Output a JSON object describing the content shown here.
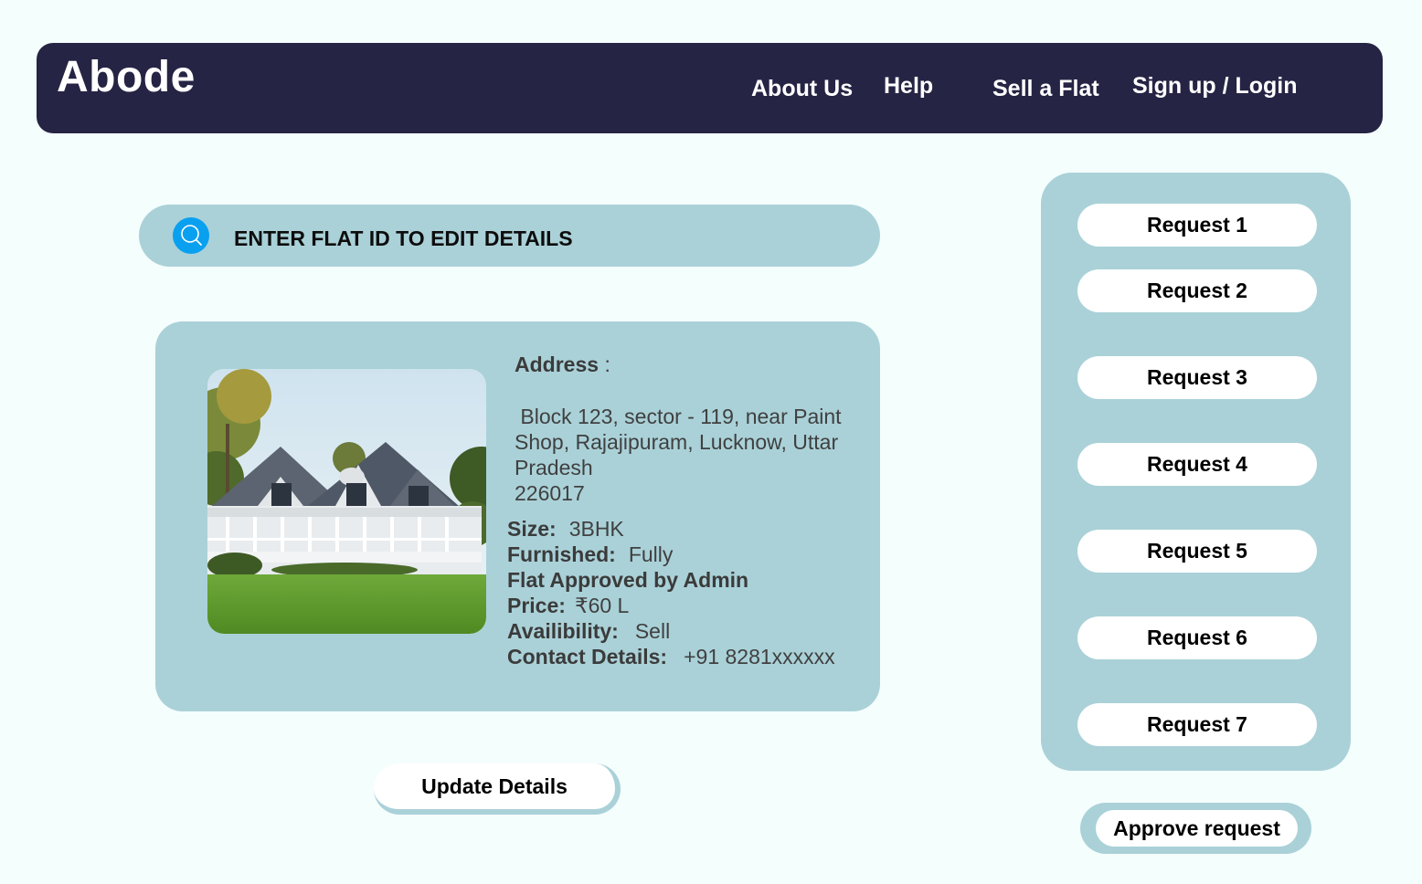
{
  "header": {
    "brand": "Abode",
    "nav": {
      "about": "About Us",
      "help": "Help",
      "sell": "Sell a Flat",
      "login": "Sign up / Login"
    }
  },
  "search": {
    "placeholder": "ENTER FLAT ID TO EDIT DETAILS",
    "icon": "search-icon"
  },
  "flat": {
    "address_label": "Address",
    "address_colon": ":",
    "address_lines": [
      " Block 123, sector - 119, near Paint",
      "Shop, Rajajipuram, Lucknow, Uttar",
      "Pradesh",
      "226017"
    ],
    "size_label": "Size:",
    "size_value": "3BHK",
    "furnished_label": "Furnished:",
    "furnished_value": "Fully",
    "approved_text": "Flat Approved by Admin",
    "price_label": "Price:",
    "price_value": "₹60 L",
    "availability_label": "Availibility:",
    "availability_value": "Sell",
    "contact_label": "Contact Details:",
    "contact_value": "+91 8281xxxxxx"
  },
  "update_button": "Update Details",
  "requests": [
    "Request 1",
    "Request 2",
    "Request 3",
    "Request 4",
    "Request 5",
    "Request 6",
    "Request 7"
  ],
  "approve_button": "Approve request",
  "colors": {
    "navbar": "#262444",
    "panel": "#aad1d8",
    "page_bg": "#f4fefd",
    "search_icon": "#0aa0f0"
  }
}
